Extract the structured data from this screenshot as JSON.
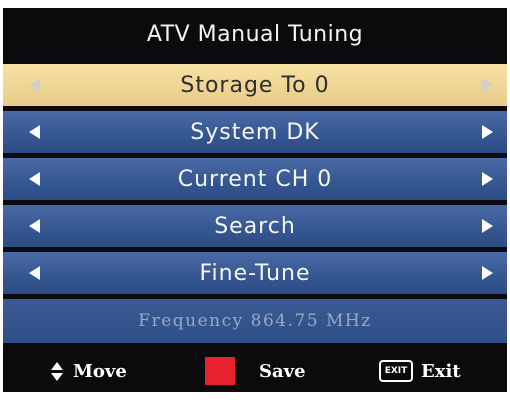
{
  "title": "ATV Manual Tuning",
  "menu": {
    "items": [
      {
        "label": "Storage To 0",
        "selected": true
      },
      {
        "label": "System DK",
        "selected": false
      },
      {
        "label": "Current CH 0",
        "selected": false
      },
      {
        "label": "Search",
        "selected": false
      },
      {
        "label": "Fine-Tune",
        "selected": false
      }
    ],
    "frequency": "Frequency 864.75 MHz"
  },
  "footer": {
    "move_label": "Move",
    "save_label": "Save",
    "exit_icon_text": "EXIT",
    "exit_label": "Exit"
  },
  "colors": {
    "selected_row": "#eed493",
    "row": "#345691",
    "save_key": "#e8212f"
  },
  "icons": [
    "left-arrow-icon",
    "right-arrow-icon",
    "up-down-arrows-icon",
    "red-key-icon",
    "exit-key-icon"
  ]
}
